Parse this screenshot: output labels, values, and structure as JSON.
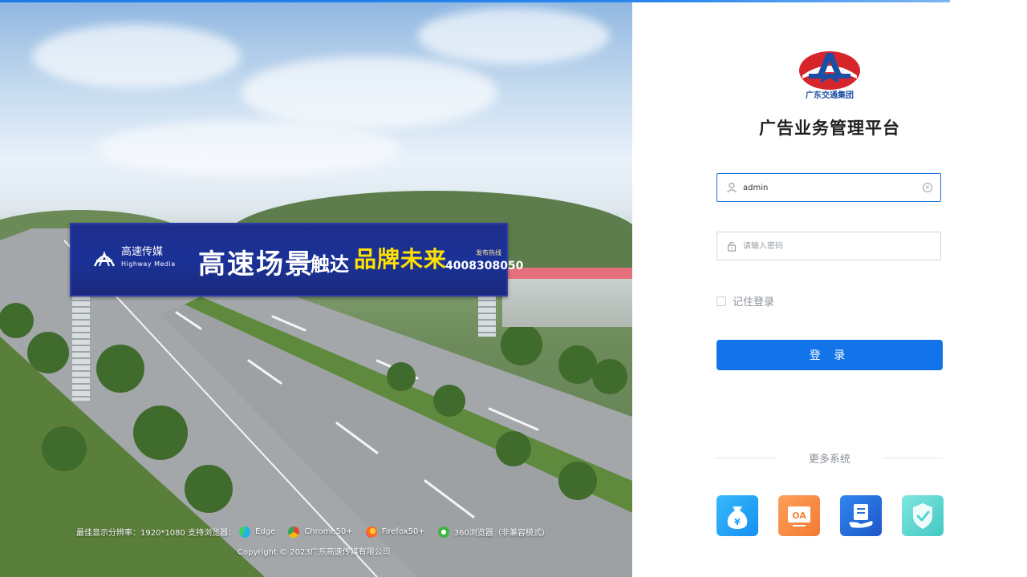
{
  "hero": {
    "billboard": {
      "brand_cn": "高速传媒",
      "brand_en": "Highway Media",
      "slogan_main": "高速场景",
      "slogan_mid": "触达",
      "slogan_yellow": "品牌未来",
      "hotline_label": "发布热线",
      "hotline": "4008308050"
    },
    "footer": {
      "resolution_text": "最佳显示分辨率：1920*1080 支持浏览器：",
      "browsers": [
        "Edge",
        "Chrome50+",
        "Firefox50+",
        "360浏览器（非兼容模式）"
      ],
      "copyright": "Copyright © 2023广东高速传媒有限公司"
    }
  },
  "login": {
    "logo_text": "广东交通集团",
    "title": "广告业务管理平台",
    "username": {
      "value": "admin",
      "icon": "user-icon"
    },
    "password": {
      "placeholder": "请输入密码",
      "icon": "lock-icon"
    },
    "remember_label": "记住登录",
    "button_label": "登 录",
    "more_systems_label": "更多系统",
    "systems": [
      {
        "icon": "money-bag-icon",
        "color": "#1aa0f5"
      },
      {
        "icon": "oa-icon",
        "color": "#f7873d"
      },
      {
        "icon": "document-hand-icon",
        "color": "#2a6fe0"
      },
      {
        "icon": "shield-check-icon",
        "color": "#4fd6cf"
      }
    ]
  },
  "colors": {
    "primary": "#1274e8",
    "accent_line": "#1e7be6"
  }
}
